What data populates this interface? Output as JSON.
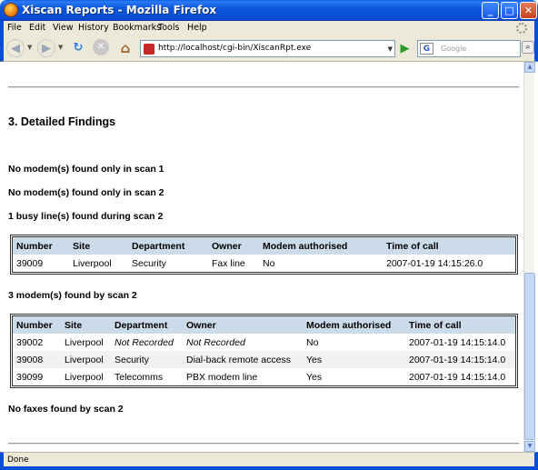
{
  "window": {
    "title": "Xiscan Reports - Mozilla Firefox"
  },
  "menu": [
    "File",
    "Edit",
    "View",
    "History",
    "Bookmarks",
    "Tools",
    "Help"
  ],
  "navbar": {
    "url": "http://localhost/cgi-bin/XiscanRpt.exe",
    "search_placeholder": "Google",
    "search_engine": "G"
  },
  "report": {
    "section_title": "3. Detailed Findings",
    "p1": "No modem(s) found only in scan 1",
    "p2": "No modem(s) found only in scan 2",
    "busy_heading": "1 busy line(s) found during scan 2",
    "busy_table": {
      "headers": [
        "Number",
        "Site",
        "Department",
        "Owner",
        "Modem authorised",
        "Time of call"
      ],
      "rows": [
        [
          "39009",
          "Liverpool",
          "Security",
          "Fax line",
          "No",
          "2007-01-19 14:15:26.0"
        ]
      ]
    },
    "modem_heading": "3 modem(s) found by scan 2",
    "modem_table": {
      "headers": [
        "Number",
        "Site",
        "Department",
        "Owner",
        "Modem authorised",
        "Time of call"
      ],
      "rows": [
        [
          "39002",
          "Liverpool",
          "Not Recorded",
          "Not Recorded",
          "No",
          "2007-01-19 14:15:14.0"
        ],
        [
          "39008",
          "Liverpool",
          "Security",
          "Dial-back remote access",
          "Yes",
          "2007-01-19 14:15:14.0"
        ],
        [
          "39099",
          "Liverpool",
          "Telecomms",
          "PBX modem line",
          "Yes",
          "2007-01-19 14:15:14.0"
        ]
      ]
    },
    "faxes": "No faxes found by scan 2"
  },
  "status": {
    "text": "Done"
  }
}
